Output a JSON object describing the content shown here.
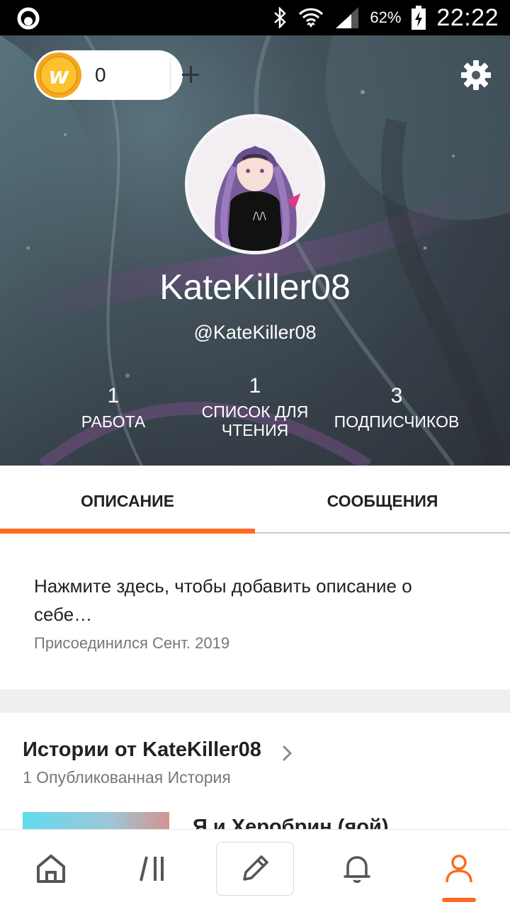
{
  "status_bar": {
    "battery_percent": "62%",
    "time": "22:22",
    "icons": [
      "app-notification-icon",
      "bluetooth-icon",
      "wifi-icon",
      "signal-icon",
      "battery-charging-icon"
    ]
  },
  "header": {
    "coins": {
      "count": "0",
      "icon": "wattpad-coin-icon",
      "add_icon": "plus-icon"
    },
    "settings_icon": "gear-icon",
    "username": "KateKiller08",
    "handle": "@KateKiller08",
    "stats": [
      {
        "value": "1",
        "label": "РАБОТА"
      },
      {
        "value": "1",
        "label": "СПИСОК ДЛЯ ЧТЕНИЯ"
      },
      {
        "value": "3",
        "label": "ПОДПИСЧИКОВ"
      }
    ]
  },
  "tabs": [
    {
      "label": "ОПИСАНИЕ",
      "active": true
    },
    {
      "label": "СООБЩЕНИЯ",
      "active": false
    }
  ],
  "accent_color": "#ff6a22",
  "description": {
    "placeholder": "Нажмите здесь, чтобы добавить описание о себе…",
    "joined": "Присоединился Сент. 2019"
  },
  "stories": {
    "title": "Истории от KateKiller08",
    "subtitle": "1 Опубликованная История",
    "items": [
      {
        "title": "Я и Херобрин (яой)"
      }
    ]
  },
  "bottom_nav": [
    {
      "icon": "home-icon",
      "active": false
    },
    {
      "icon": "library-icon",
      "active": false
    },
    {
      "icon": "pencil-icon",
      "active": false
    },
    {
      "icon": "bell-icon",
      "active": false
    },
    {
      "icon": "profile-icon",
      "active": true
    }
  ]
}
